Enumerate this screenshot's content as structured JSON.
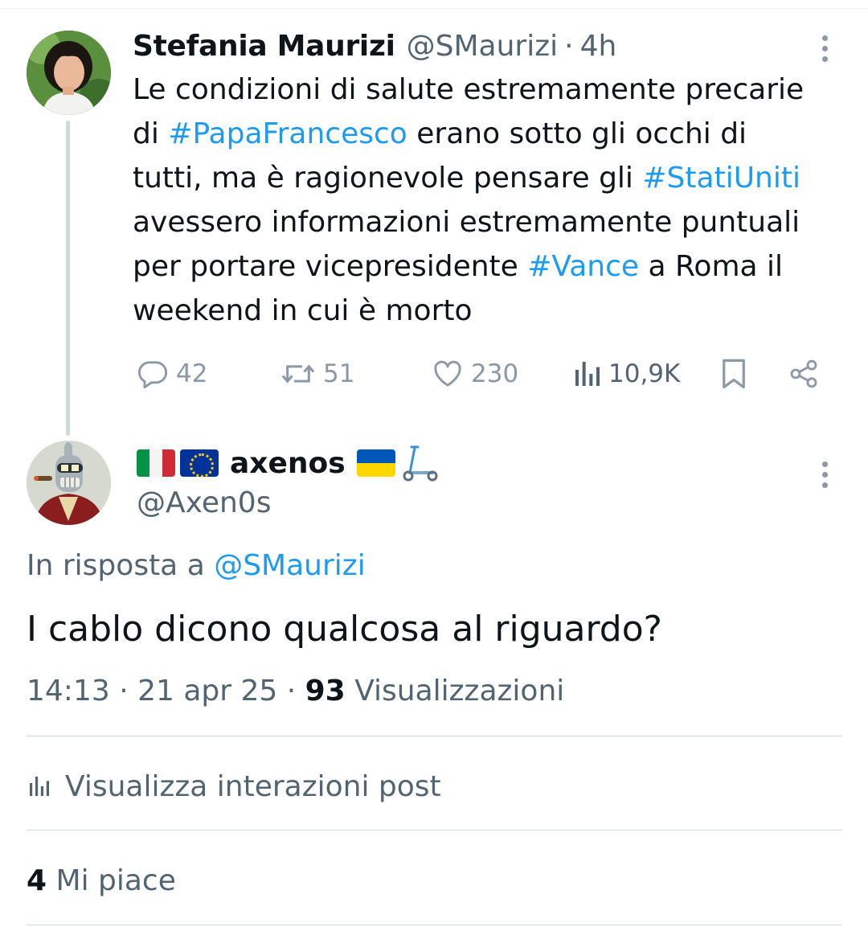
{
  "parent_tweet": {
    "author_name": "Stefania Maurizi",
    "handle": "@SMaurizi",
    "separator": "·",
    "time": "4h",
    "text_lines": [
      [
        {
          "t": "Le condizioni di salute estremamente precarie"
        }
      ],
      [
        {
          "t": "di "
        },
        {
          "t": "#PapaFrancesco",
          "tag": true
        },
        {
          "t": " erano sotto gli occhi di"
        }
      ],
      [
        {
          "t": "tutti, ma è ragionevole pensare gli "
        },
        {
          "t": "#StatiUniti",
          "tag": true
        }
      ],
      [
        {
          "t": "avessero informazioni estremamente puntuali"
        }
      ],
      [
        {
          "t": "per portare vicepresidente "
        },
        {
          "t": "#Vance",
          "tag": true
        },
        {
          "t": " a Roma il"
        }
      ],
      [
        {
          "t": "weekend in cui è morto"
        }
      ]
    ],
    "stats": {
      "replies": "42",
      "reposts": "51",
      "likes": "230",
      "views": "10,9K"
    }
  },
  "reply_tweet": {
    "author_name": "axenos",
    "handle": "@Axen0s",
    "in_reply_prefix": "In risposta a",
    "in_reply_handle": "@SMaurizi",
    "text": "I cablo dicono qualcosa al riguardo?",
    "timestamp": "14:13 · 21 apr 25 · ",
    "views_count": "93",
    "views_label": "Visualizzazioni",
    "interactions_label": "Visualizza interazioni post",
    "likes_count": "4",
    "likes_label": "Mi piace"
  },
  "colors": {
    "link": "#1d9bf0",
    "secondary_text": "#536471",
    "icon_gray": "#8b98a5",
    "thread_line": "#cfd9de"
  }
}
